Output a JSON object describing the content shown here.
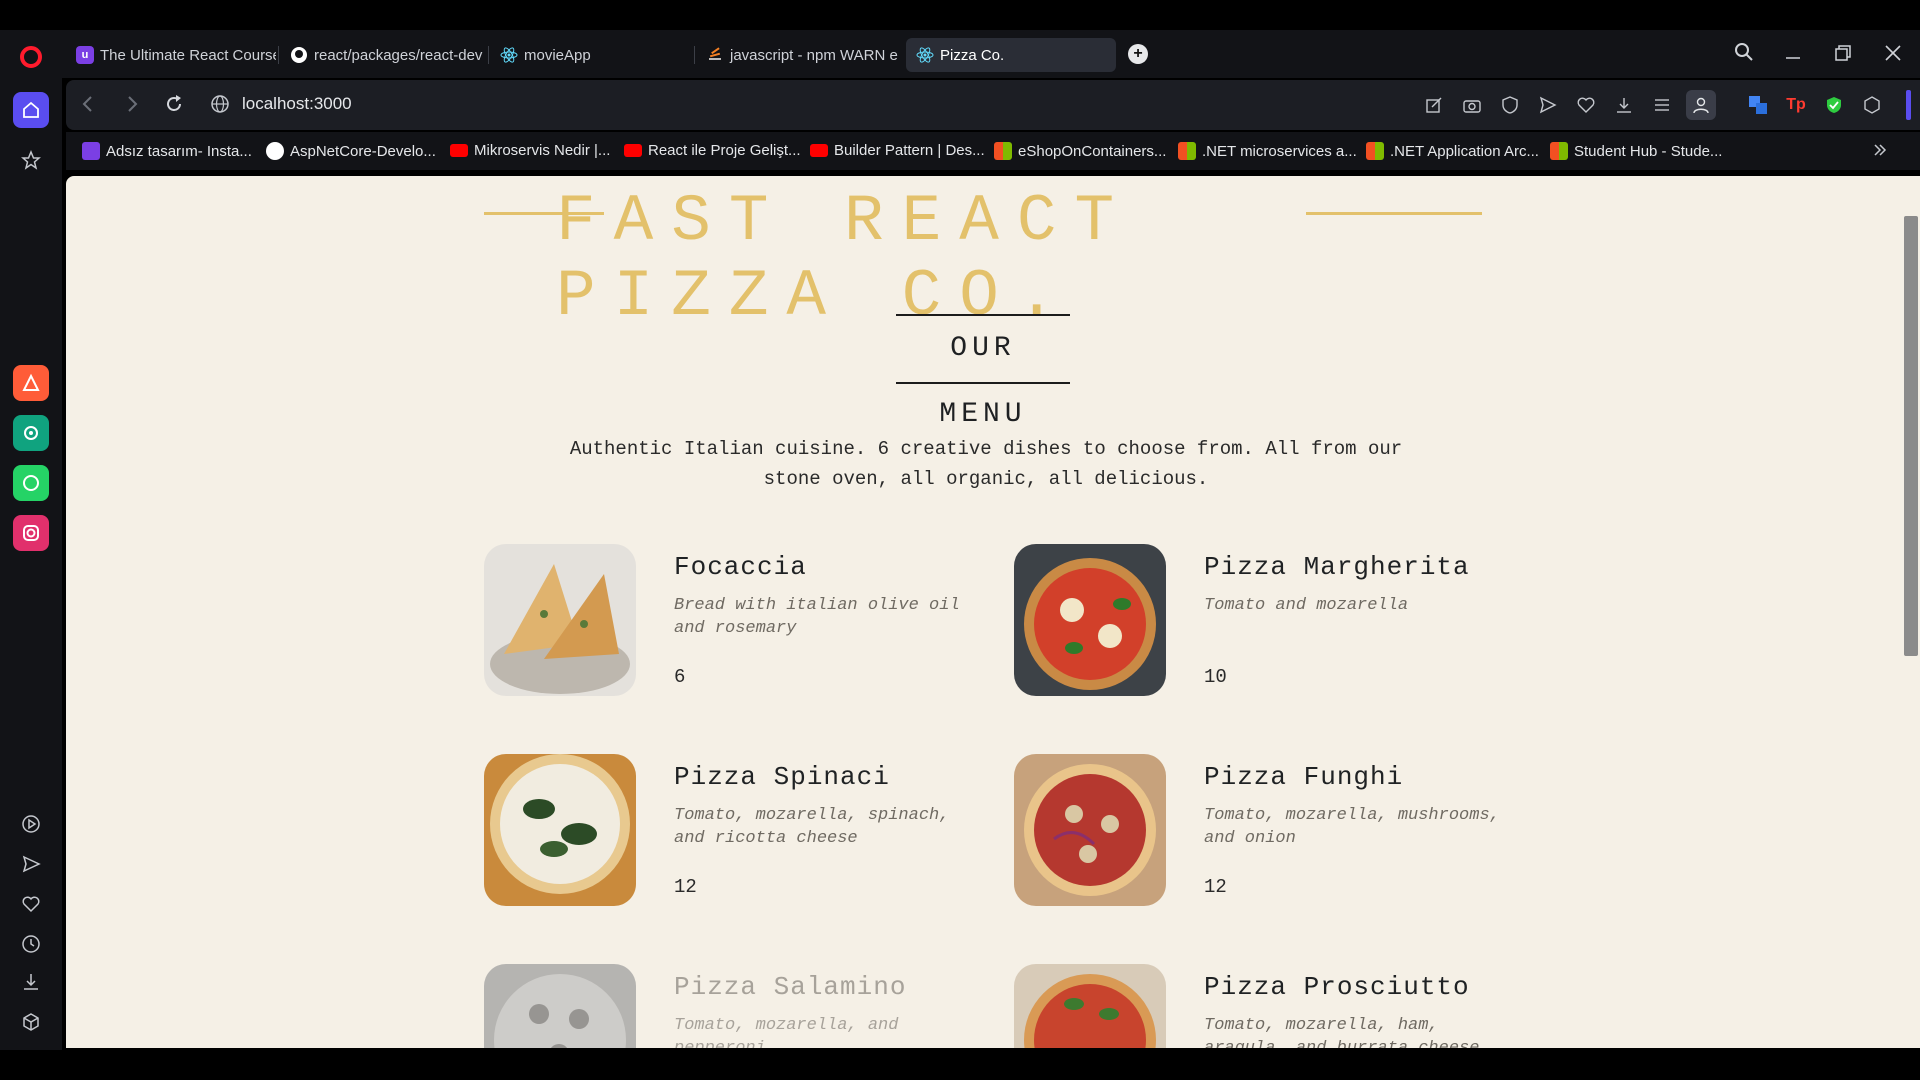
{
  "browser": {
    "tabs": [
      {
        "label": "The Ultimate React Course",
        "favicon_color": "#7b3fe4"
      },
      {
        "label": "react/packages/react-dev",
        "favicon_color": "#ffffff"
      },
      {
        "label": "movieApp",
        "favicon_color": "#61dafb"
      },
      {
        "label": "javascript - npm WARN e",
        "favicon_color": "#f48024"
      },
      {
        "label": "Pizza Co.",
        "favicon_color": "#61dafb",
        "active": true
      }
    ],
    "new_tab_symbol": "+",
    "url": "localhost:3000",
    "bookmarks": [
      {
        "label": "Adsız tasarım- Insta...",
        "icon": "heart-icon",
        "color": "#7b3fe4"
      },
      {
        "label": "AspNetCore-Develo...",
        "icon": "github-icon",
        "color": "#ffffff"
      },
      {
        "label": "Mikroservis Nedir |...",
        "icon": "youtube-icon",
        "color": "#ff0000"
      },
      {
        "label": "React ile Proje Gelişt...",
        "icon": "youtube-icon",
        "color": "#ff0000"
      },
      {
        "label": "Builder Pattern | Des...",
        "icon": "youtube-icon",
        "color": "#ff0000"
      },
      {
        "label": "eShopOnContainers...",
        "icon": "microsoft-icon",
        "color": "#f25022"
      },
      {
        "label": ".NET microservices a...",
        "icon": "microsoft-icon",
        "color": "#f25022"
      },
      {
        "label": ".NET Application Arc...",
        "icon": "microsoft-icon",
        "color": "#f25022"
      },
      {
        "label": "Student Hub - Stude...",
        "icon": "microsoft-icon",
        "color": "#f25022"
      }
    ]
  },
  "page": {
    "brand": "FAST REACT PIZZA CO.",
    "menu_heading": "OUR MENU",
    "intro": "Authentic Italian cuisine. 6 creative dishes to choose from. All from our stone oven, all organic, all delicious.",
    "accent_color": "#e3c16b",
    "items": [
      {
        "name": "Focaccia",
        "description": "Bread with italian olive oil and rosemary",
        "price": "6",
        "sold_out": false
      },
      {
        "name": "Pizza Margherita",
        "description": "Tomato and mozarella",
        "price": "10",
        "sold_out": false
      },
      {
        "name": "Pizza Spinaci",
        "description": "Tomato, mozarella, spinach, and ricotta cheese",
        "price": "12",
        "sold_out": false
      },
      {
        "name": "Pizza Funghi",
        "description": "Tomato, mozarella, mushrooms, and onion",
        "price": "12",
        "sold_out": false
      },
      {
        "name": "Pizza Salamino",
        "description": "Tomato, mozarella, and pepperoni",
        "price": "",
        "sold_out": true
      },
      {
        "name": "Pizza Prosciutto",
        "description": "Tomato, mozarella, ham, aragula, and burrata cheese",
        "price": "",
        "sold_out": false
      }
    ]
  }
}
